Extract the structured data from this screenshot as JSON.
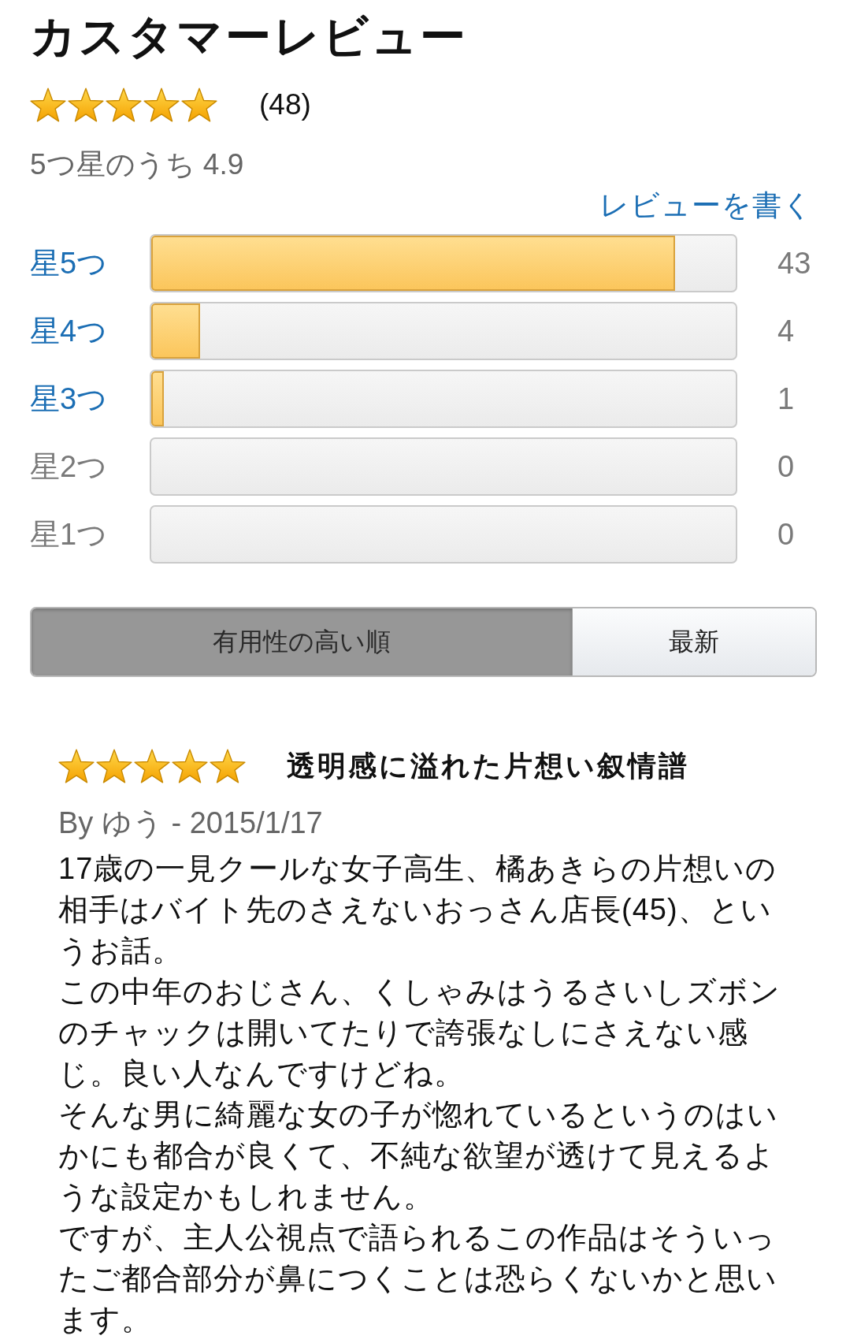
{
  "header": {
    "title": "カスタマーレビュー"
  },
  "summary": {
    "stars": 5,
    "count": "(48)",
    "rating_text": "5つ星のうち 4.9",
    "write_review": "レビューを書く"
  },
  "histogram": [
    {
      "label": "星5つ",
      "level": 0.896,
      "count": "43",
      "disabled": false
    },
    {
      "label": "星4つ",
      "level": 0.083,
      "count": "4",
      "disabled": false
    },
    {
      "label": "星3つ",
      "level": 0.021,
      "count": "1",
      "disabled": false
    },
    {
      "label": "星2つ",
      "level": 0,
      "count": "0",
      "disabled": true
    },
    {
      "label": "星1つ",
      "level": 0,
      "count": "0",
      "disabled": true
    }
  ],
  "sort_tabs": [
    {
      "label": "有用性の高い順",
      "selected": true
    },
    {
      "label": "最新",
      "selected": false
    }
  ],
  "reviews": [
    {
      "stars": 5,
      "title": "透明感に溢れた片想い叙情譜",
      "byline": "By ゆう - 2015/1/17",
      "paragraphs": [
        "17歳の一見クールな女子高生、橘あきらの片想いの相手はバイト先のさえないおっさん店長(45)、というお話。",
        "この中年のおじさん、くしゃみはうるさいしズボンのチャックは開いてたりで誇張なしにさえない感じ。良い人なんですけどね。",
        "そんな男に綺麗な女の子が惚れているというのはいかにも都合が良くて、不純な欲望が透けて見えるような設定かもしれません。",
        "ですが、主人公視点で語られるこの作品はそういったご都合部分が鼻につくことは恐らくないかと思います。"
      ]
    }
  ]
}
